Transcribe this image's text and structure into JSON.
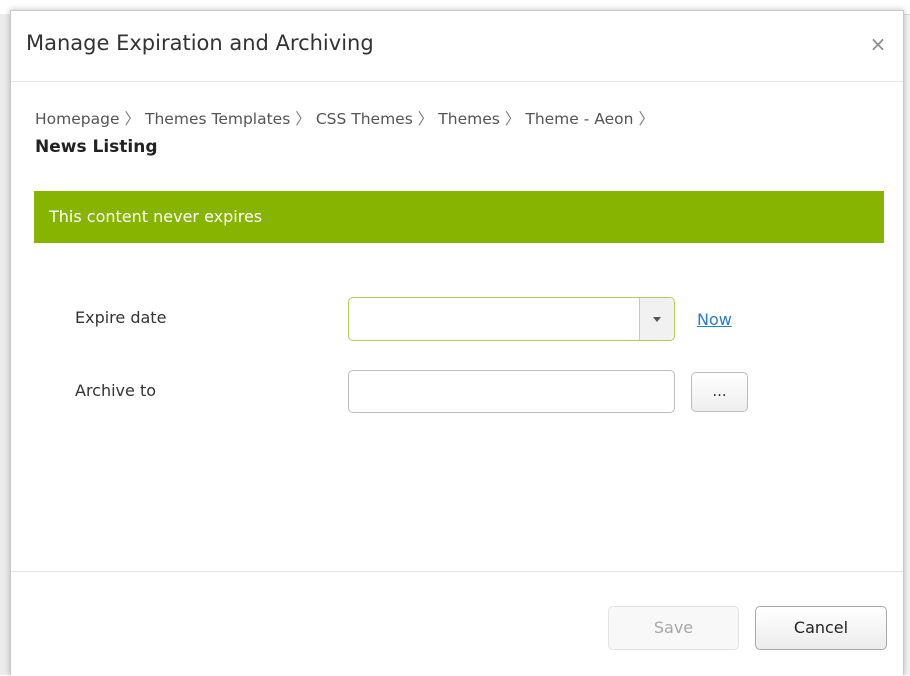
{
  "dialog": {
    "title": "Manage Expiration and Archiving",
    "close_glyph": "×"
  },
  "breadcrumb": {
    "items": [
      "Homepage",
      "Themes Templates",
      "CSS Themes",
      "Themes",
      "Theme - Aeon"
    ],
    "separator": "〉",
    "current": "News Listing"
  },
  "status": {
    "message": "This content never expires",
    "color": "#86b400"
  },
  "form": {
    "expire_label": "Expire date",
    "expire_value": "",
    "now_link": "Now",
    "archive_label": "Archive to",
    "archive_value": "",
    "browse_label": "..."
  },
  "footer": {
    "save_label": "Save",
    "save_enabled": false,
    "cancel_label": "Cancel"
  },
  "colors": {
    "accent_link": "#2a7bc8",
    "dialog_border": "#c9c9c9"
  }
}
